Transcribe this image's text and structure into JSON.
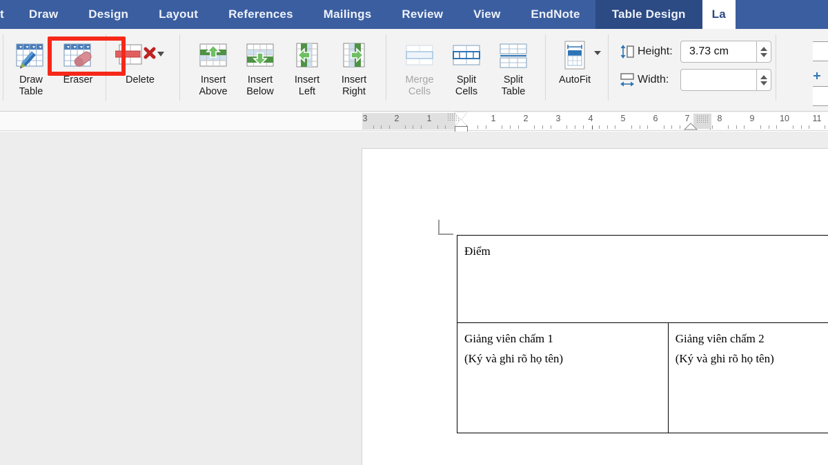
{
  "ribbon_tabs": [
    {
      "label": "t",
      "state": "clipped"
    },
    {
      "label": "Draw",
      "state": "normal"
    },
    {
      "label": "Design",
      "state": "normal"
    },
    {
      "label": "Layout",
      "state": "normal"
    },
    {
      "label": "References",
      "state": "normal"
    },
    {
      "label": "Mailings",
      "state": "normal"
    },
    {
      "label": "Review",
      "state": "normal"
    },
    {
      "label": "View",
      "state": "normal"
    },
    {
      "label": "EndNote",
      "state": "normal"
    },
    {
      "label": "Table Design",
      "state": "contextual"
    },
    {
      "label": "La",
      "state": "active"
    }
  ],
  "ribbon": {
    "draw_group": [
      {
        "name": "draw-table",
        "label": "Draw\nTable",
        "label_line1": "Draw",
        "label_line2": "Table",
        "icon": "draw-table-icon",
        "disabled": false
      },
      {
        "name": "eraser",
        "label": "Eraser",
        "label_line1": "Eraser",
        "label_line2": "",
        "icon": "eraser-icon",
        "disabled": false,
        "highlighted": true
      }
    ],
    "delete_group": [
      {
        "name": "delete",
        "label": "Delete",
        "label_line1": "Delete",
        "label_line2": "",
        "icon": "delete-table-icon",
        "disabled": false,
        "has_dropdown": true
      }
    ],
    "insert_group": [
      {
        "name": "insert-above",
        "label_line1": "Insert",
        "label_line2": "Above",
        "icon": "insert-row-above-icon",
        "disabled": false
      },
      {
        "name": "insert-below",
        "label_line1": "Insert",
        "label_line2": "Below",
        "icon": "insert-row-below-icon",
        "disabled": false
      },
      {
        "name": "insert-left",
        "label_line1": "Insert",
        "label_line2": "Left",
        "icon": "insert-column-left-icon",
        "disabled": false
      },
      {
        "name": "insert-right",
        "label_line1": "Insert",
        "label_line2": "Right",
        "icon": "insert-column-right-icon",
        "disabled": false
      }
    ],
    "merge_group": [
      {
        "name": "merge-cells",
        "label_line1": "Merge",
        "label_line2": "Cells",
        "icon": "merge-cells-icon",
        "disabled": true
      },
      {
        "name": "split-cells",
        "label_line1": "Split",
        "label_line2": "Cells",
        "icon": "split-cells-icon",
        "disabled": false
      },
      {
        "name": "split-table",
        "label_line1": "Split",
        "label_line2": "Table",
        "icon": "split-table-icon",
        "disabled": false
      }
    ],
    "autofit_group": [
      {
        "name": "autofit",
        "label_line1": "AutoFit",
        "label_line2": "",
        "icon": "autofit-icon",
        "disabled": false,
        "has_dropdown": true
      }
    ],
    "cell_size": {
      "height_label": "Height:",
      "height_value": "3.73 cm",
      "height_icon": "height-arrows-icon",
      "width_label": "Width:",
      "width_value": "",
      "width_placeholder": "",
      "width_icon": "width-arrows-icon"
    }
  },
  "ruler": {
    "left_labels": [
      "3",
      "2",
      "1"
    ],
    "right_labels": [
      "1",
      "2",
      "3",
      "4",
      "5",
      "6",
      "7",
      "8",
      "9",
      "10",
      "11"
    ],
    "units": "cm"
  },
  "document": {
    "table": {
      "rows": [
        {
          "name": "score-row",
          "cells": [
            {
              "lines": [
                "Điểm"
              ]
            }
          ]
        },
        {
          "name": "signature-row",
          "cells": [
            {
              "lines": [
                "Giảng viên chấm 1",
                "(Ký và ghi rõ họ tên)"
              ]
            },
            {
              "lines": [
                "Giảng viên chấm 2",
                "(Ký và ghi rõ họ tên)"
              ]
            }
          ]
        }
      ]
    }
  },
  "annotation": {
    "highlight_target": "Eraser",
    "color": "#f62819"
  },
  "colors": {
    "ribbon_blue": "#3b5ea0",
    "contextual_tab_blue": "#2c4a84",
    "ribbon_body": "#f3f3f3",
    "workspace_grey": "#ededed",
    "page_white": "#ffffff",
    "accent_red": "#f62819"
  }
}
